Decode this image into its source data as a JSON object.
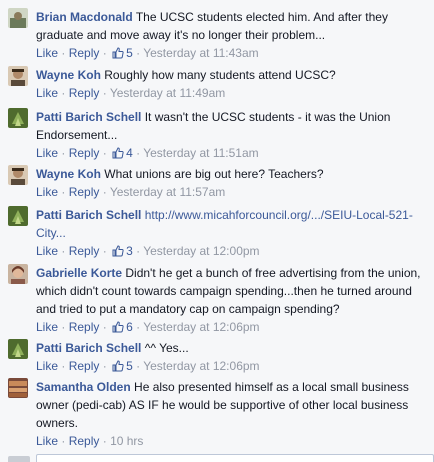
{
  "comments": [
    {
      "author": "Brian Macdonald",
      "text": "The UCSC students elected him. And after they graduate and move away it's no longer their problem...",
      "like_label": "Like",
      "reply_label": "Reply",
      "likes": "5",
      "time": "Yesterday at 11:43am",
      "avatar_color": "#7a8a6a"
    },
    {
      "author": "Wayne Koh",
      "text": "Roughly how many students attend UCSC?",
      "like_label": "Like",
      "reply_label": "Reply",
      "likes": "",
      "time": "Yesterday at 11:49am",
      "avatar_color": "#8a6a5a"
    },
    {
      "author": "Patti Barich Schell",
      "text": "It wasn't the UCSC students - it was the Union Endorsement...",
      "like_label": "Like",
      "reply_label": "Reply",
      "likes": "4",
      "time": "Yesterday at 11:51am",
      "avatar_color": "#5c7a3a"
    },
    {
      "author": "Wayne Koh",
      "text": "What unions are big out here? Teachers?",
      "like_label": "Like",
      "reply_label": "Reply",
      "likes": "",
      "time": "Yesterday at 11:57am",
      "avatar_color": "#8a6a5a"
    },
    {
      "author": "Patti Barich Schell",
      "text": "",
      "link_text": "http://www.micahforcouncil.org/.../SEIU-Local-521-City...",
      "like_label": "Like",
      "reply_label": "Reply",
      "likes": "3",
      "time": "Yesterday at 12:00pm",
      "avatar_color": "#5c7a3a"
    },
    {
      "author": "Gabrielle Korte",
      "text": "Didn't he get a bunch of free advertising from the union, which didn't count towards campaign spending...then he turned around and tried to put a mandatory cap on campaign spending?",
      "like_label": "Like",
      "reply_label": "Reply",
      "likes": "6",
      "time": "Yesterday at 12:06pm",
      "avatar_color": "#9a7a6a"
    },
    {
      "author": "Patti Barich Schell",
      "text": "^^ Yes...",
      "like_label": "Like",
      "reply_label": "Reply",
      "likes": "5",
      "time": "Yesterday at 12:06pm",
      "avatar_color": "#5c7a3a"
    },
    {
      "author": "Samantha Olden",
      "text": "He also presented himself as a local small business owner (pedi-cab) AS IF he would be supportive of other local business owners.",
      "like_label": "Like",
      "reply_label": "Reply",
      "likes": "",
      "time": "10 hrs",
      "avatar_color": "#a06a4a"
    }
  ],
  "separator": "·",
  "colors": {
    "link": "#3b5998",
    "meta": "#9197a3",
    "text": "#141823",
    "background": "#f6f7f9"
  }
}
